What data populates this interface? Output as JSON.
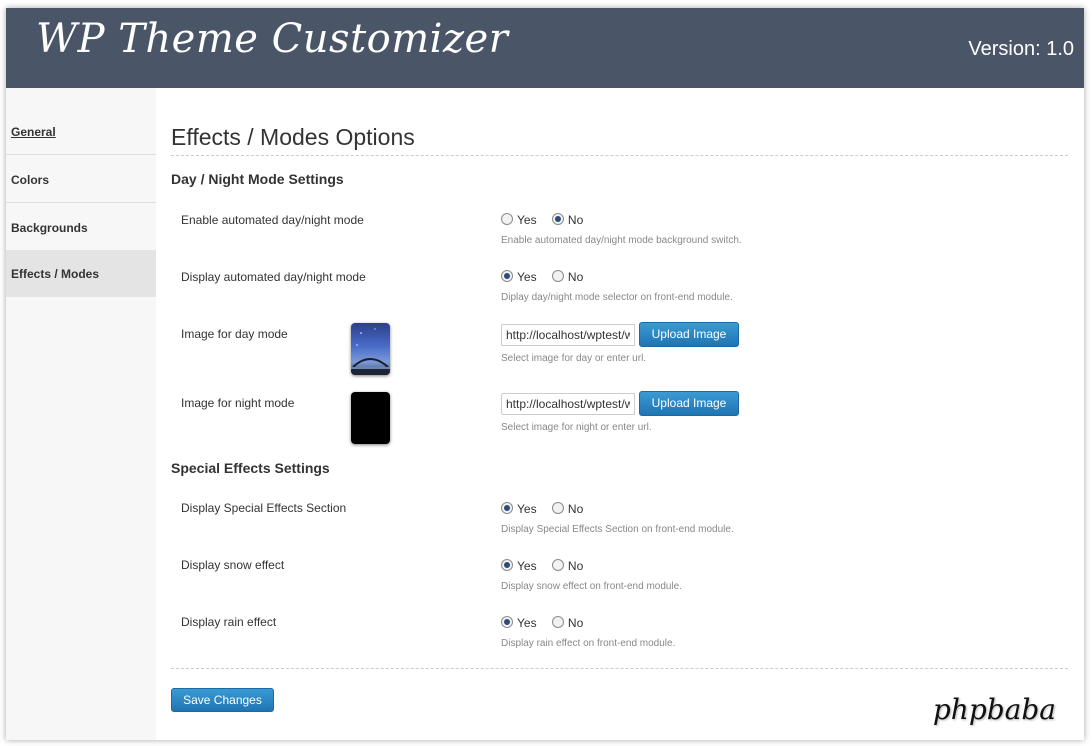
{
  "header": {
    "app_title": "WP Theme Customizer",
    "version": "Version: 1.0"
  },
  "sidebar": {
    "items": [
      {
        "label": "General"
      },
      {
        "label": "Colors"
      },
      {
        "label": "Backgrounds"
      },
      {
        "label": "Effects / Modes"
      }
    ]
  },
  "main": {
    "page_title": "Effects / Modes Options",
    "sections": [
      {
        "title": "Day / Night Mode Settings"
      },
      {
        "title": "Special Effects Settings"
      }
    ],
    "fields": {
      "enable_daynight": {
        "label": "Enable automated day/night mode",
        "yes": "Yes",
        "no": "No",
        "selected": "No",
        "help": "Enable automated day/night mode background switch."
      },
      "display_daynight": {
        "label": "Display automated day/night mode",
        "yes": "Yes",
        "no": "No",
        "selected": "Yes",
        "help": "Diplay day/night mode selector on front-end module."
      },
      "day_image": {
        "label": "Image for day mode",
        "value": "http://localhost/wptest/wp-content/uploads/day.jpg",
        "button": "Upload Image",
        "help": "Select image for day or enter url."
      },
      "night_image": {
        "label": "Image for night mode",
        "value": "http://localhost/wptest/wp-content/uploads/night.jpg",
        "button": "Upload Image",
        "help": "Select image for night or enter url."
      },
      "special_effects": {
        "label": "Display Special Effects Section",
        "yes": "Yes",
        "no": "No",
        "selected": "Yes",
        "help": "Display Special Effects Section on front-end module."
      },
      "snow": {
        "label": "Display snow effect",
        "yes": "Yes",
        "no": "No",
        "selected": "Yes",
        "help": "Display snow effect on front-end module."
      },
      "rain": {
        "label": "Display rain effect",
        "yes": "Yes",
        "no": "No",
        "selected": "Yes",
        "help": "Display rain effect on front-end module."
      }
    },
    "save_label": "Save Changes"
  },
  "footer": {
    "brand": "phpbaba"
  }
}
